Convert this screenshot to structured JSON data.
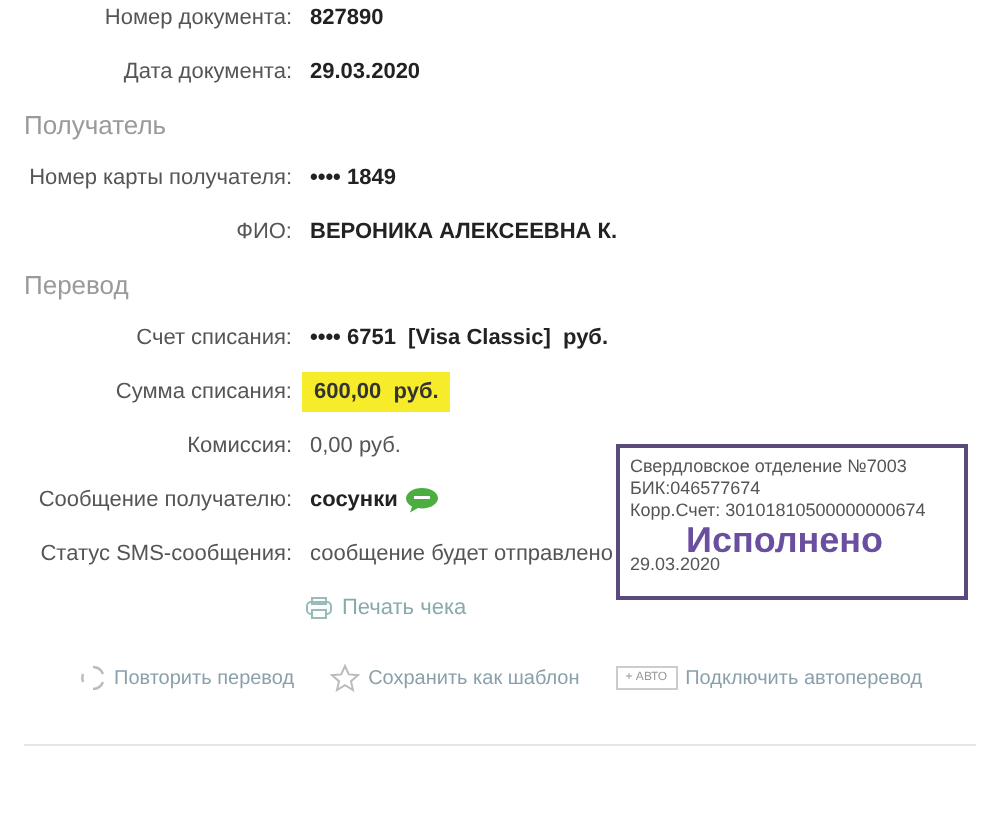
{
  "top_rows": [
    {
      "label": "Номер документа:",
      "value": "827890",
      "kind": "bold"
    },
    {
      "label": "Дата документа:",
      "value": "29.03.2020",
      "kind": "bold"
    }
  ],
  "sections": [
    {
      "title": "Получатель",
      "rows": [
        {
          "label": "Номер карты получателя:",
          "value": "•••• 1849",
          "kind": "bold"
        },
        {
          "label": "ФИО:",
          "value": "ВЕРОНИКА АЛЕКСЕЕВНА К.",
          "kind": "bold"
        }
      ]
    },
    {
      "title": "Перевод",
      "rows": [
        {
          "label": "Счет списания:",
          "value": "•••• 6751  [Visa Classic]  руб.",
          "kind": "bold"
        },
        {
          "label": "Сумма списания:",
          "value": "600,00  руб.",
          "kind": "highlight"
        },
        {
          "label": "Комиссия:",
          "value": "0,00 руб.",
          "kind": "plain"
        },
        {
          "label": "Сообщение получателю:",
          "value": "сосунки",
          "kind": "sms"
        },
        {
          "label": "Статус SMS-сообщения:",
          "value": "сообщение будет отправлено",
          "kind": "plain"
        }
      ]
    }
  ],
  "stamp": {
    "lines": [
      "Свердловское отделение №7003",
      "БИК:046577674",
      "Корр.Счет: 30101810500000000674"
    ],
    "status": "Исполнено",
    "date": "29.03.2020"
  },
  "print_link": "Печать чека",
  "actions": [
    {
      "kind": "repeat",
      "label": "Повторить перевод"
    },
    {
      "kind": "template",
      "label": "Сохранить как шаблон"
    },
    {
      "kind": "auto",
      "badge": "+ АВТО",
      "label": "Подключить автоперевод"
    }
  ]
}
